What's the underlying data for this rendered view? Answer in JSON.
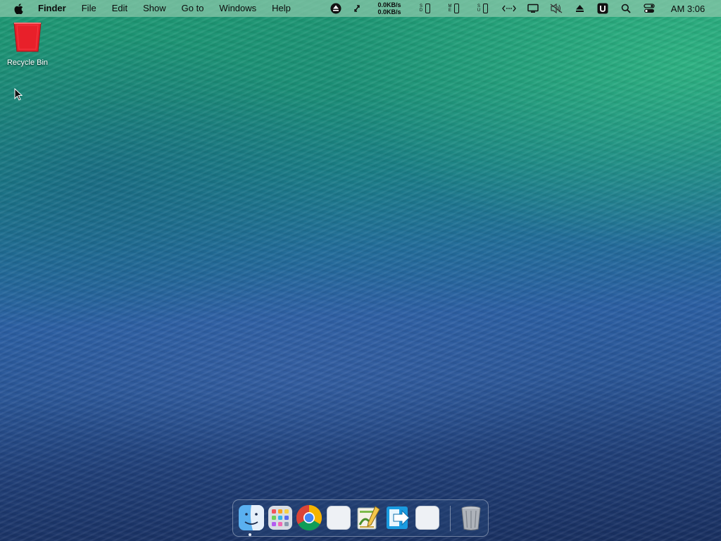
{
  "menubar": {
    "app_name": "Finder",
    "menus": [
      "File",
      "Edit",
      "Show",
      "Go to",
      "Windows",
      "Help"
    ],
    "status": {
      "upload_speed": "0.0KB/s",
      "download_speed": "0.0KB/s",
      "device_labels": [
        [
          "S",
          "D"
        ],
        [
          "M",
          "E"
        ],
        [
          "S",
          "U"
        ]
      ],
      "clock": "AM 3:06",
      "icons": [
        "eject-circle-icon",
        "sync-arrows-icon",
        "phone-icon",
        "network-arrows-icon",
        "display-icon",
        "mute-icon",
        "eject-icon",
        "u-app-icon",
        "search-icon",
        "control-center-icon"
      ]
    }
  },
  "desktop": {
    "icons": [
      {
        "label": "Recycle Bin",
        "icon": "recycle-bin-icon",
        "color": "#e8202a"
      }
    ]
  },
  "dock": {
    "apps": [
      {
        "name": "Finder",
        "icon": "finder-icon",
        "running": true
      },
      {
        "name": "Launchpad",
        "icon": "launchpad-icon",
        "running": false
      },
      {
        "name": "Google Chrome",
        "icon": "chrome-icon",
        "running": false
      },
      {
        "name": "Blank App 1",
        "icon": "blank-app-icon",
        "running": false
      },
      {
        "name": "Pen Editor",
        "icon": "pen-editor-icon",
        "running": false
      },
      {
        "name": "Migration App",
        "icon": "arrow-app-icon",
        "running": false
      },
      {
        "name": "Blank App 2",
        "icon": "blank-app-icon",
        "running": false
      }
    ],
    "trash": {
      "name": "Trash",
      "icon": "trash-icon"
    }
  }
}
